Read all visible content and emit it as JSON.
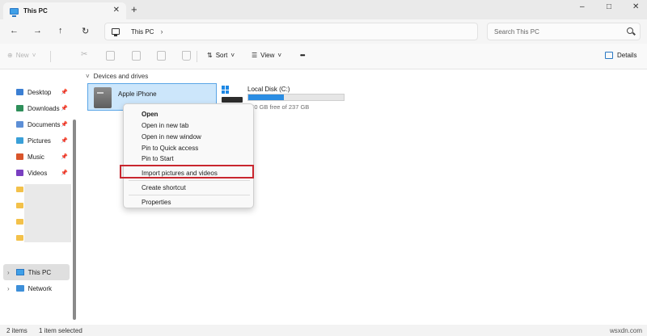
{
  "window": {
    "tab_title": "This PC",
    "new_tab": "+",
    "controls": {
      "minimize": "–",
      "maximize": "□",
      "close": "✕"
    }
  },
  "nav": {
    "back": "←",
    "forward": "→",
    "up": "↑",
    "refresh": "↻",
    "breadcrumb": "This PC",
    "breadcrumb_chevron": "›",
    "search_placeholder": "Search This PC"
  },
  "toolbar": {
    "new_label": "New",
    "new_chevron": "˅",
    "sort_label": "Sort",
    "view_label": "View",
    "more_label": "•••",
    "details_label": "Details"
  },
  "sidebar": {
    "quick_access": [
      {
        "label": "Desktop",
        "color": "#3b7fd3"
      },
      {
        "label": "Downloads",
        "color": "#2e8f5a"
      },
      {
        "label": "Documents",
        "color": "#5d8fd6"
      },
      {
        "label": "Pictures",
        "color": "#3aa0d8"
      },
      {
        "label": "Music",
        "color": "#d9552b"
      },
      {
        "label": "Videos",
        "color": "#7a3fc1"
      }
    ],
    "pin_icon": "📌",
    "this_pc": "This PC",
    "network": "Network",
    "expand_chevron": "›"
  },
  "main": {
    "section_title": "Devices and drives",
    "section_chevron": "˅",
    "devices": [
      {
        "name": "Apple iPhone"
      },
      {
        "name": "Local Disk (C:)",
        "free_text": "150 GB free of 237 GB",
        "used_fraction": 0.37
      }
    ]
  },
  "context_menu": {
    "items": [
      {
        "label": "Open",
        "bold": true
      },
      {
        "label": "Open in new tab"
      },
      {
        "label": "Open in new window"
      },
      {
        "label": "Pin to Quick access"
      },
      {
        "label": "Pin to Start"
      },
      {
        "label": "Import pictures and videos",
        "highlighted": true
      },
      {
        "label": "Create shortcut"
      },
      {
        "label": "Properties"
      }
    ],
    "highlight_color": "#c9262e"
  },
  "status_bar": {
    "items_count": "2 items",
    "selected": "1 item selected"
  },
  "watermark": "wsxdn.com",
  "colors": {
    "accent": "#2b8de3",
    "selection": "#cce6fb"
  }
}
